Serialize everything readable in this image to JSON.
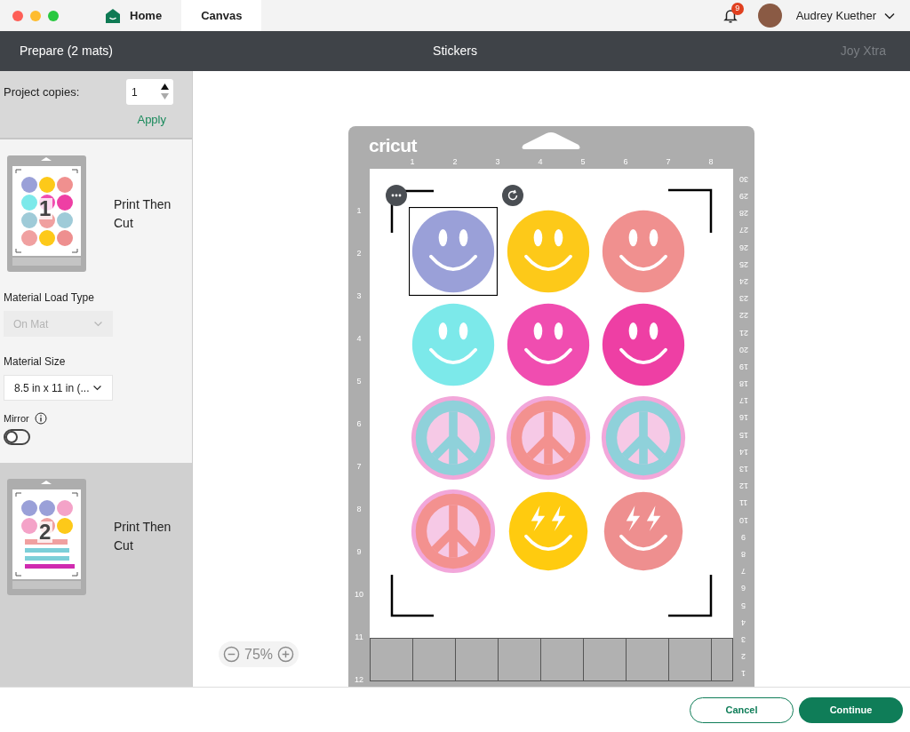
{
  "tabs": [
    {
      "label": "Home",
      "kind": "home",
      "selected": false
    },
    {
      "label": "Canvas",
      "kind": "plain",
      "selected": true
    }
  ],
  "notifications": {
    "count": "9"
  },
  "user": {
    "name": "Audrey Kuether"
  },
  "header": {
    "left": "Prepare (2 mats)",
    "title": "Stickers",
    "machine": {
      "label": "Joy Xtra",
      "disabled": true
    }
  },
  "sidebar": {
    "copies": {
      "label": "Project copies:",
      "value": "1",
      "action": "Apply"
    },
    "mats": [
      {
        "number": "1",
        "kind": "stickers",
        "mode": "Print Then Cut",
        "selected": true,
        "settings": {
          "load_type": {
            "label": "Material Load Type",
            "value": "On Mat",
            "disabled": true
          },
          "size": {
            "label": "Material Size",
            "value": "8.5 in x 11 in (...",
            "disabled": false
          },
          "mirror": {
            "label": "Mirror",
            "on": false
          }
        }
      },
      {
        "number": "2",
        "kind": "names",
        "mode": "Print Then Cut",
        "selected": false
      }
    ]
  },
  "canvas": {
    "logo": "cricut",
    "top_ruler": [
      "1",
      "2",
      "3",
      "4",
      "5",
      "6",
      "7",
      "8"
    ],
    "left_ruler": [
      "1",
      "2",
      "3",
      "4",
      "5",
      "6",
      "7",
      "8",
      "9",
      "10",
      "11",
      "12"
    ],
    "right_ruler": [
      "30",
      "29",
      "28",
      "27",
      "26",
      "25",
      "24",
      "23",
      "22",
      "21",
      "20",
      "19",
      "18",
      "17",
      "16",
      "15",
      "14",
      "13",
      "12",
      "11",
      "10",
      "9",
      "8",
      "7",
      "6",
      "5",
      "4",
      "3",
      "2",
      "1"
    ],
    "stickers": [
      {
        "kind": "smiley",
        "color": "#9aa0d8",
        "selected": true
      },
      {
        "kind": "smiley",
        "color": "#fdc919",
        "selected": false
      },
      {
        "kind": "smiley",
        "color": "#f0908f",
        "selected": false
      },
      {
        "kind": "smiley",
        "color": "#7ce9ea",
        "selected": false
      },
      {
        "kind": "smiley",
        "color": "#f04db0",
        "selected": false
      },
      {
        "kind": "smiley",
        "color": "#ee3fa4",
        "selected": false
      },
      {
        "kind": "peace",
        "color": "#8fd1da",
        "selected": false
      },
      {
        "kind": "peace",
        "color": "#f3918f",
        "selected": false
      },
      {
        "kind": "peace",
        "color": "#8fd1da",
        "selected": false
      },
      {
        "kind": "peace",
        "color": "#f3918f",
        "selected": false
      },
      {
        "kind": "bolt",
        "color": "#ffcb0f",
        "selected": false
      },
      {
        "kind": "bolt",
        "color": "#ee8f8f",
        "selected": false
      }
    ],
    "zoom": {
      "value": "75%",
      "disabled": true
    }
  },
  "footer": {
    "buttons": [
      {
        "label": "Cancel",
        "kind": "secondary"
      },
      {
        "label": "Continue",
        "kind": "primary"
      }
    ]
  }
}
